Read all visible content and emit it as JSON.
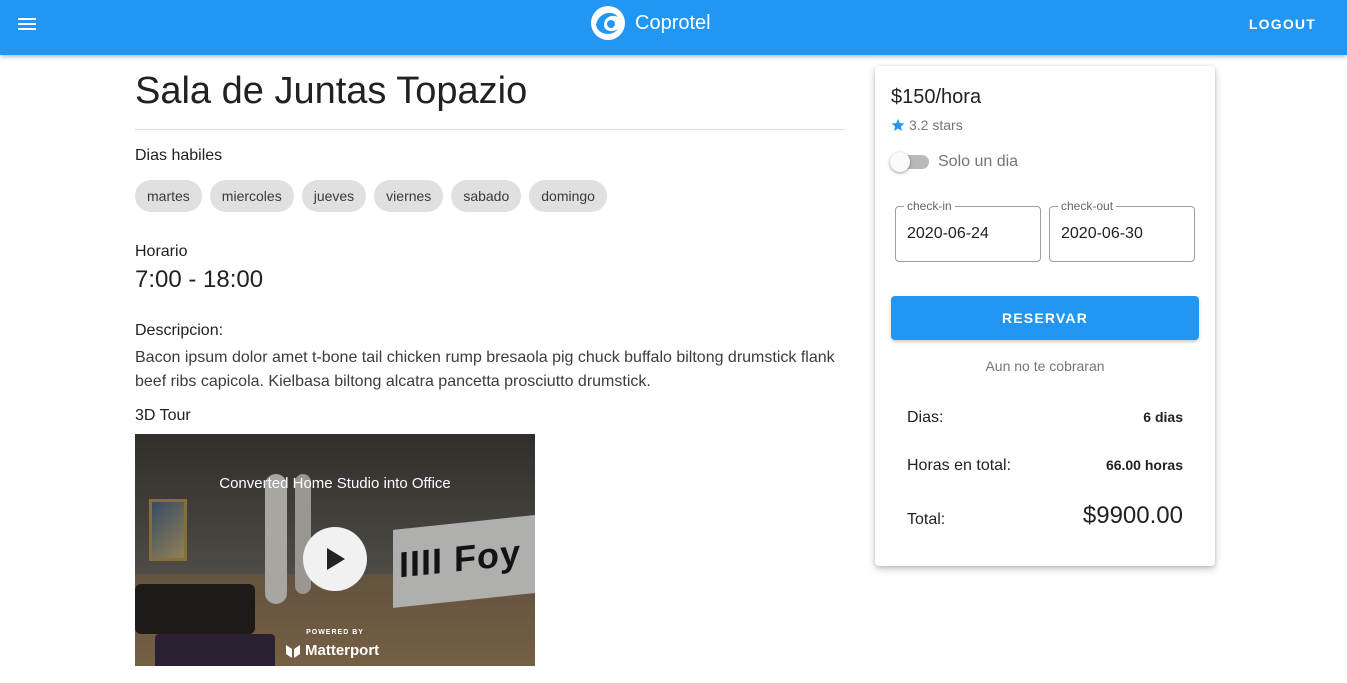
{
  "header": {
    "brand_name": "Coprotel",
    "logout_label": "LOGOUT",
    "color": "#2196f3"
  },
  "room": {
    "title": "Sala de Juntas Topazio",
    "days_label": "Dias habiles",
    "days": [
      "martes",
      "miercoles",
      "jueves",
      "viernes",
      "sabado",
      "domingo"
    ],
    "schedule_label": "Horario",
    "schedule_value": "7:00 - 18:00",
    "description_label": "Descripcion:",
    "description_text": "Bacon ipsum dolor amet t-bone tail chicken rump bresaola pig chuck buffalo biltong drumstick flank beef ribs capicola. Kielbasa biltong alcatra pancetta prosciutto drumstick.",
    "tour_label": "3D Tour"
  },
  "tour": {
    "title": "Converted Home Studio into Office",
    "banner_text": "IIII Foy",
    "powered_by": "POWERED BY",
    "provider": "Matterport"
  },
  "booking": {
    "price": "$150/hora",
    "rating": "3.2 stars",
    "single_day_label": "Solo un dia",
    "single_day_on": false,
    "checkin_label": "check-in",
    "checkin_value": "2020-06-24",
    "checkout_label": "check-out",
    "checkout_value": "2020-06-30",
    "reserve_label": "RESERVAR",
    "notice": "Aun no te cobraran",
    "days_label": "Dias:",
    "days_value": "6 dias",
    "hours_label": "Horas en total:",
    "hours_value": "66.00 horas",
    "total_label": "Total:",
    "total_value": "$9900.00",
    "accent": "#2196f3",
    "star_color": "#2196f3"
  }
}
